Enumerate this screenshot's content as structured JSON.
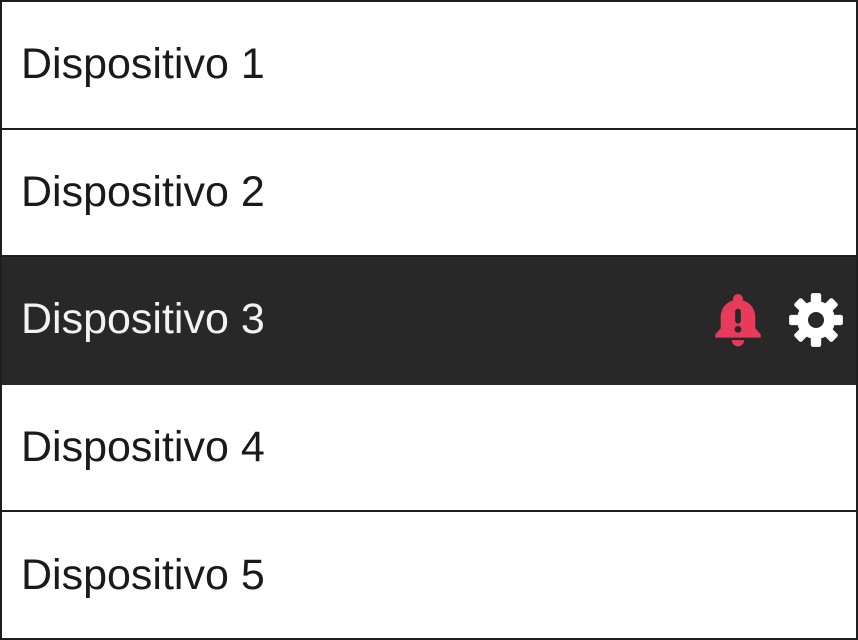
{
  "devices": [
    {
      "label": "Dispositivo 1",
      "selected": false
    },
    {
      "label": "Dispositivo 2",
      "selected": false
    },
    {
      "label": "Dispositivo 3",
      "selected": true
    },
    {
      "label": "Dispositivo 4",
      "selected": false
    },
    {
      "label": "Dispositivo 5",
      "selected": false
    }
  ],
  "icons": {
    "alert": "bell-exclamation-icon",
    "settings": "gear-icon"
  },
  "colors": {
    "selected_background": "#282828",
    "alert_icon": "#e83a5a",
    "settings_icon": "#ffffff"
  }
}
